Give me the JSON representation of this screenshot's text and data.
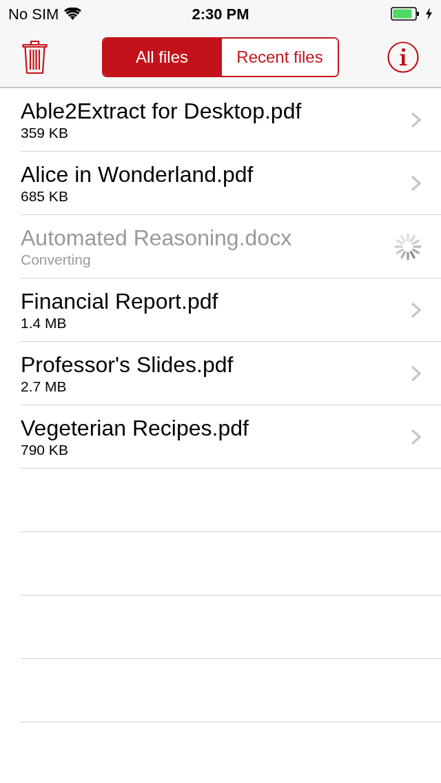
{
  "status_bar": {
    "carrier": "No SIM",
    "time": "2:30 PM"
  },
  "nav_bar": {
    "segments": [
      {
        "label": "All files",
        "selected": true
      },
      {
        "label": "Recent files",
        "selected": false
      }
    ]
  },
  "files": [
    {
      "name": "Able2Extract for Desktop.pdf",
      "detail": "359 KB",
      "kind": "ready"
    },
    {
      "name": "Alice in Wonderland.pdf",
      "detail": "685 KB",
      "kind": "ready"
    },
    {
      "name": "Automated Reasoning.docx",
      "detail": "Converting",
      "kind": "converting"
    },
    {
      "name": "Financial Report.pdf",
      "detail": "1.4 MB",
      "kind": "ready"
    },
    {
      "name": "Professor's Slides.pdf",
      "detail": "2.7 MB",
      "kind": "ready"
    },
    {
      "name": "Vegeterian Recipes.pdf",
      "detail": "790 KB",
      "kind": "ready"
    }
  ]
}
